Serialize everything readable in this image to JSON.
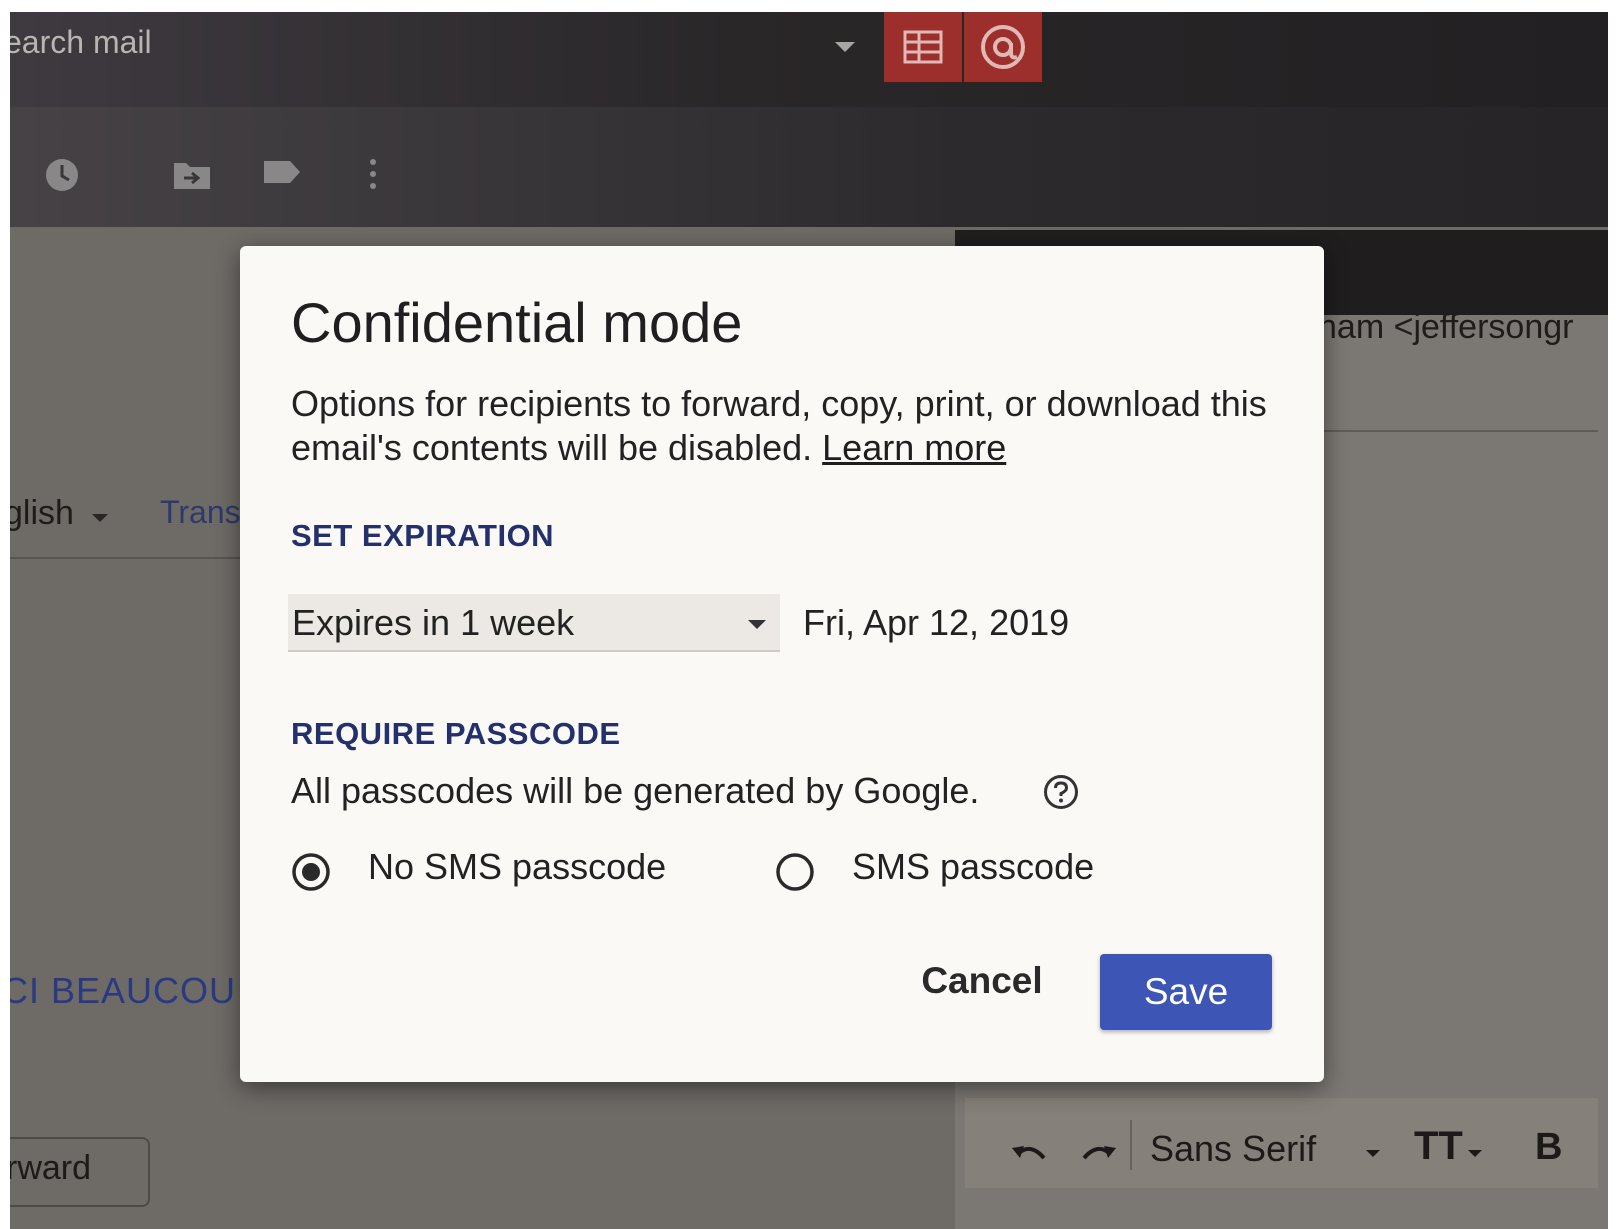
{
  "background": {
    "search": {
      "placeholder": "Search mail",
      "visible_text": "earch mail"
    },
    "app_icons": [
      "table-icon",
      "at-sign-icon"
    ],
    "toolbar_icons": [
      "snooze-icon",
      "move-to-icon",
      "label-icon",
      "more-vert-icon"
    ],
    "recipient_partial": "ham <jeffersongr",
    "language_partial": "glish",
    "translate_partial": "Trans",
    "sender_partial": "CI BEAUCOU",
    "forward_partial": "rward",
    "format_bar": {
      "font": "Sans Serif",
      "icons": [
        "undo-icon",
        "redo-icon",
        "text-size-icon",
        "bold-icon"
      ],
      "bold_glyph": "B",
      "size_glyph": "TT"
    }
  },
  "dialog": {
    "title": "Confidential mode",
    "description": "Options for recipients to forward, copy, print, or download this email's contents will be disabled.",
    "learn_more": "Learn more",
    "expiration": {
      "label": "SET EXPIRATION",
      "selected": "Expires in 1 week",
      "date": "Fri, Apr 12, 2019"
    },
    "passcode": {
      "label": "REQUIRE PASSCODE",
      "info": "All passcodes will be generated by Google.",
      "options": [
        {
          "label": "No SMS passcode",
          "selected": true
        },
        {
          "label": "SMS passcode",
          "selected": false
        }
      ]
    },
    "buttons": {
      "cancel": "Cancel",
      "save": "Save"
    }
  },
  "colors": {
    "accent": "#3d55b4",
    "section_label": "#24306b",
    "app_button": "#9c2e2c"
  }
}
